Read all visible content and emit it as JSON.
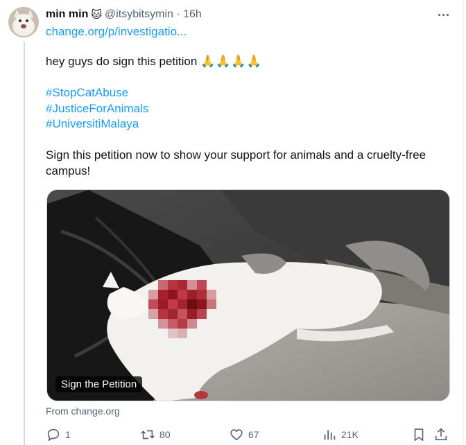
{
  "tweet": {
    "author_name": "min min",
    "author_emoji": "🐱",
    "handle_time": "@itsybitsymin · 16h",
    "top_link": "change.org/p/investigatio...",
    "text_line1": "hey guys do sign this petition",
    "prayer_emojis": "🙏🙏🙏🙏",
    "hashtags": [
      "#StopCatAbuse",
      "#JusticeForAnimals",
      "#UniversitiMalaya"
    ],
    "text_body": "Sign this petition now to show your support for animals and a cruelty-free campus!"
  },
  "card": {
    "label": "Sign the Petition",
    "source": "From change.org"
  },
  "actions": {
    "replies": "1",
    "reposts": "80",
    "likes": "67",
    "views": "21K"
  },
  "icons": [
    "more-icon",
    "reply-icon",
    "repost-icon",
    "like-icon",
    "views-icon",
    "bookmark-icon",
    "share-icon"
  ]
}
